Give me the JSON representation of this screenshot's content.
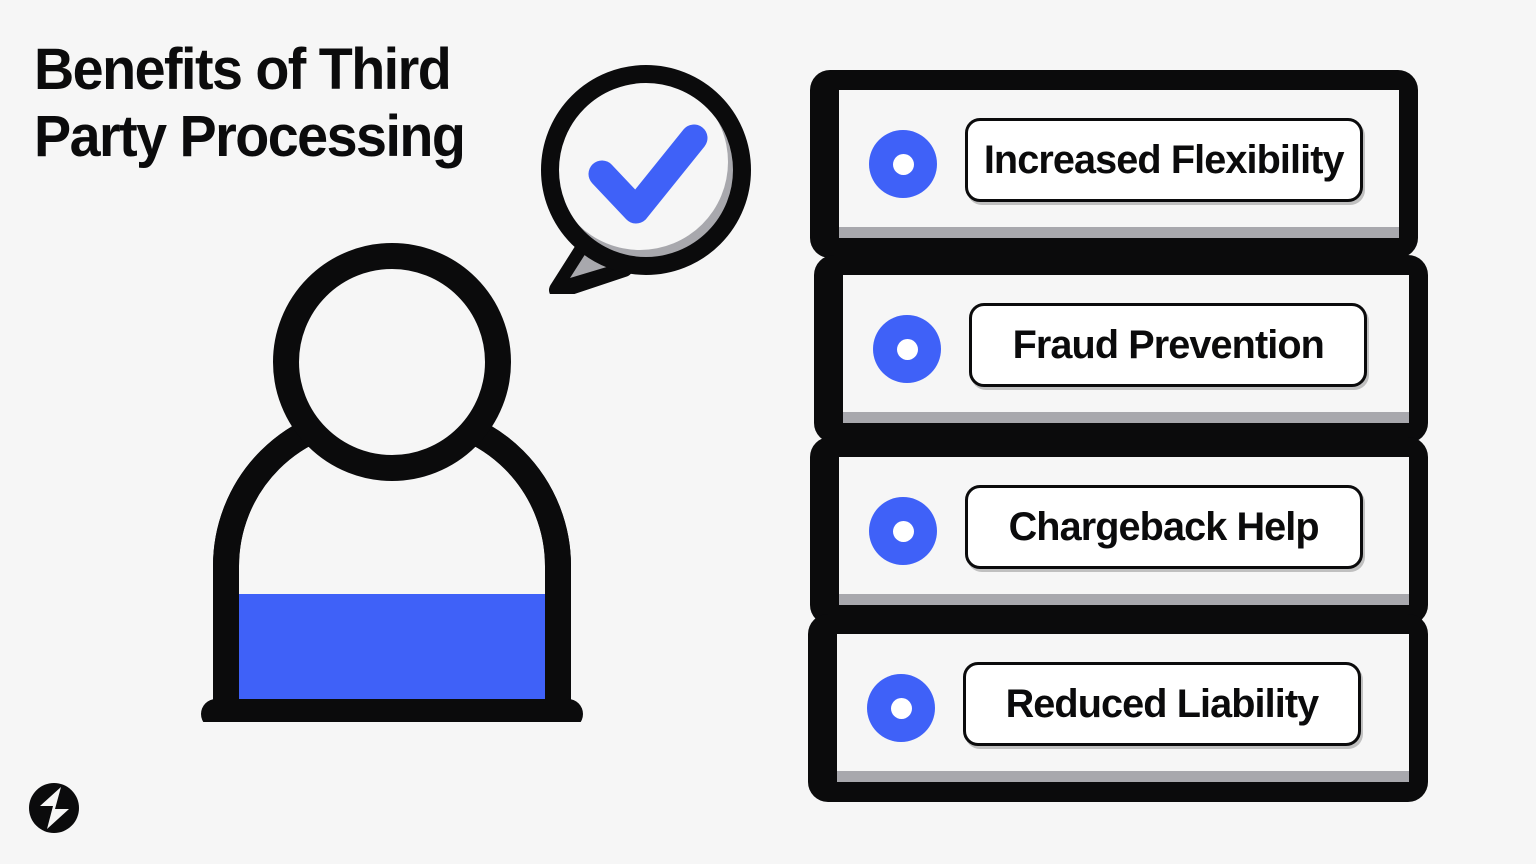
{
  "page": {
    "background_color": "#f6f6f6",
    "accent_color": "#3f61f8",
    "ink_color": "#0b0b0c",
    "shadow_gray": "#a8a8ad"
  },
  "header": {
    "title": "Benefits of Third\nParty Processing"
  },
  "illustration": {
    "speech_bubble": {
      "icon_name": "speech-bubble-with-checkmark",
      "check_color": "#3f61f8"
    },
    "person": {
      "icon_name": "person-half-filled",
      "fill_color": "#3f61f8",
      "fill_level_percent": 50
    },
    "logo": {
      "icon_name": "lightning-bolt-circle-logo"
    }
  },
  "benefits": {
    "bullet_icon_name": "blue-donut-bullet-icon",
    "items": [
      {
        "label": "Increased Flexibility"
      },
      {
        "label": "Fraud Prevention"
      },
      {
        "label": "Chargeback Help"
      },
      {
        "label": "Reduced Liability"
      }
    ]
  }
}
